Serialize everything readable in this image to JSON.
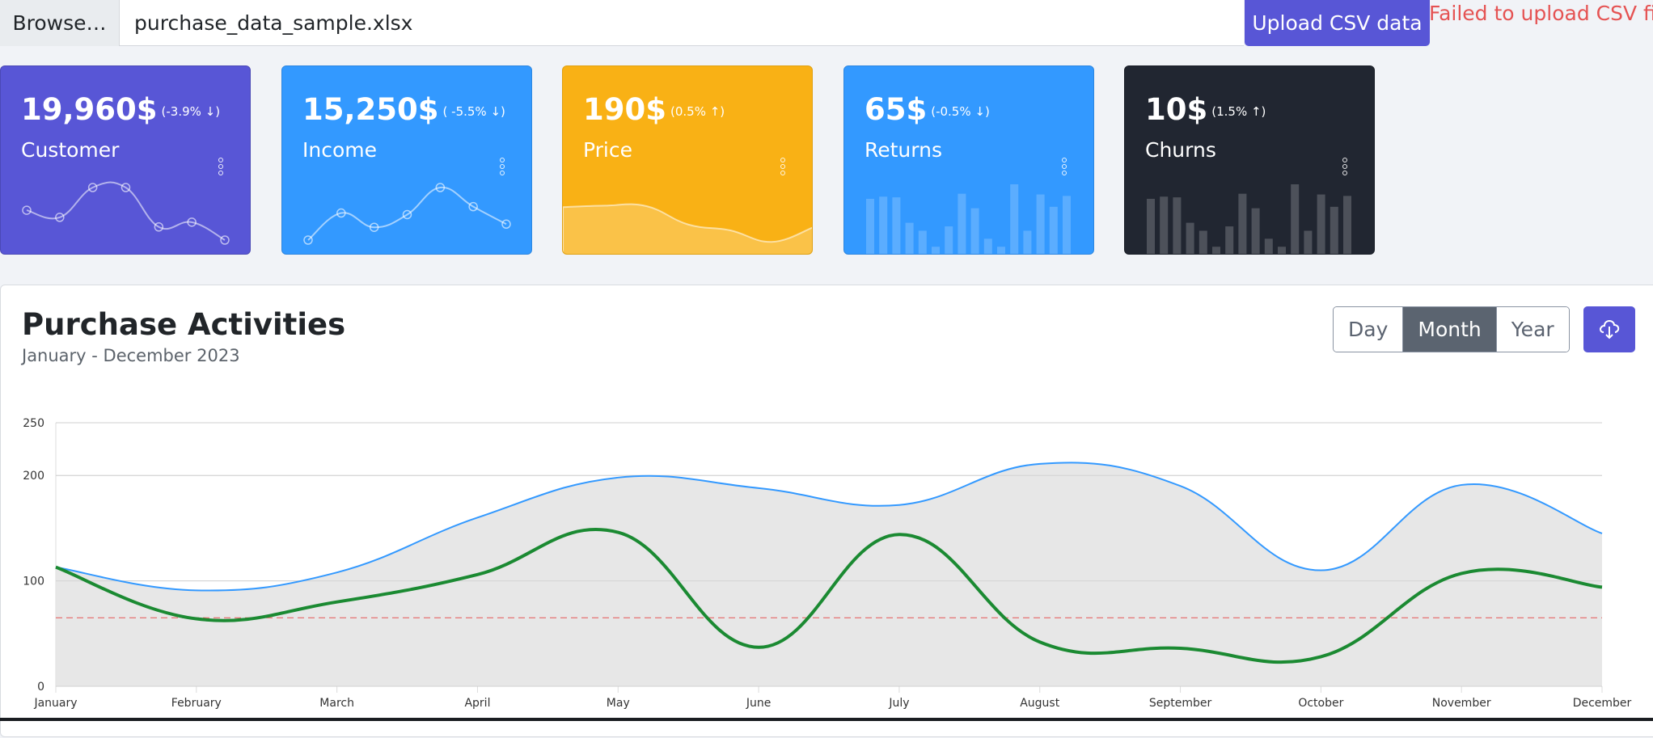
{
  "upload": {
    "browse_label": "Browse…",
    "file_name": "purchase_data_sample.xlsx",
    "upload_label": "Upload CSV data",
    "error_text": "Failed to upload CSV file."
  },
  "cards": [
    {
      "value": "19,960$",
      "delta": "(-3.9% ↓)",
      "label": "Customer",
      "color": "#5856d6",
      "sparkline": [
        65,
        59,
        84,
        84,
        51,
        55,
        40
      ]
    },
    {
      "value": "15,250$",
      "delta": "( -5.5% ↓)",
      "label": "Income",
      "color": "#3399ff",
      "sparkline": [
        1,
        18,
        9,
        17,
        34,
        22,
        11
      ]
    },
    {
      "value": "190$",
      "delta": "(0.5% ↑)",
      "label": "Price",
      "color": "#f9b115",
      "sparkline": [
        78,
        81,
        80,
        45,
        34,
        12,
        40
      ]
    },
    {
      "value": "65$",
      "delta": "(-0.5% ↓)",
      "label": "Returns",
      "color": "#3399ff",
      "sparkline": [
        78,
        81,
        80,
        45,
        34,
        12,
        40,
        85,
        65,
        23,
        12,
        98,
        34,
        84,
        67,
        82
      ]
    },
    {
      "value": "10$",
      "delta": "(1.5% ↑)",
      "label": "Churns",
      "color": "#212631",
      "sparkline": [
        78,
        81,
        80,
        45,
        34,
        12,
        40,
        85,
        65,
        23,
        12,
        98,
        34,
        84,
        67,
        82
      ]
    }
  ],
  "main": {
    "title": "Purchase Activities",
    "subtitle": "January - December 2023",
    "period_options": [
      "Day",
      "Month",
      "Year"
    ],
    "active_period": "Month",
    "download_icon": "cloud-download-icon"
  },
  "chart_data": {
    "type": "line",
    "categories": [
      "January",
      "February",
      "March",
      "April",
      "May",
      "June",
      "July",
      "August",
      "September",
      "October",
      "November",
      "December"
    ],
    "yticks": [
      0,
      100,
      200,
      250
    ],
    "ylim": [
      0,
      250
    ],
    "grid": true,
    "series": [
      {
        "values": [
          113,
          91,
          108,
          160,
          198,
          188,
          172,
          211,
          190,
          110,
          191,
          145
        ],
        "color": "#3399ff",
        "fill": "#e4e4e4"
      },
      {
        "values": [
          113,
          64,
          80,
          106,
          146,
          37,
          144,
          42,
          36,
          28,
          107,
          94
        ],
        "color": "#1b8a32"
      }
    ],
    "threshold": {
      "value": 65,
      "style": "dashed",
      "color": "#e55353"
    }
  }
}
